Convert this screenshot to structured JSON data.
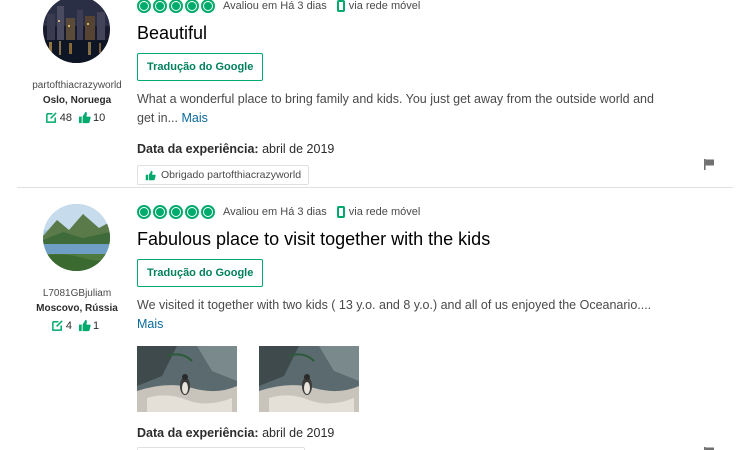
{
  "reviews": [
    {
      "username": "partofthiacrazyworld",
      "location": "Oslo, Noruega",
      "contributions": "48",
      "helpful_votes": "10",
      "rating": 5,
      "rated_date": "Avaliou em Há 3 dias",
      "mobile_label": "via rede móvel",
      "title": "Beautiful",
      "translate_label": "Tradução do Google",
      "text": "What a wonderful place to bring family and kids. You just get away from the outside world and get in...",
      "more_label": "Mais",
      "exp_label": "Data da experiência:",
      "exp_value": "abril de 2019",
      "thanks_label": "Obrigado partofthiacrazyworld"
    },
    {
      "username": "L7081GBjuliam",
      "location": "Moscovo, Rússia",
      "contributions": "4",
      "helpful_votes": "1",
      "rating": 5,
      "rated_date": "Avaliou em Há 3 dias",
      "mobile_label": "via rede móvel",
      "title": "Fabulous place to visit together with the kids",
      "translate_label": "Tradução do Google",
      "text": "We visited it together with two kids ( 13 y.o. and 8 y.o.) and all of us enjoyed the Oceanario....",
      "more_label": "Mais",
      "exp_label": "Data da experiência:",
      "exp_value": "abril de 2019"
    }
  ],
  "colors": {
    "accent": "#00aa6c",
    "link": "#0a6a9c",
    "divider": "#e0e0e0"
  },
  "icons": [
    "city-night-avatar",
    "lake-mountain-avatar",
    "review-count-icon",
    "thumbs-up-icon",
    "mobile-icon",
    "flag-icon",
    "rating-bubble-icon"
  ]
}
